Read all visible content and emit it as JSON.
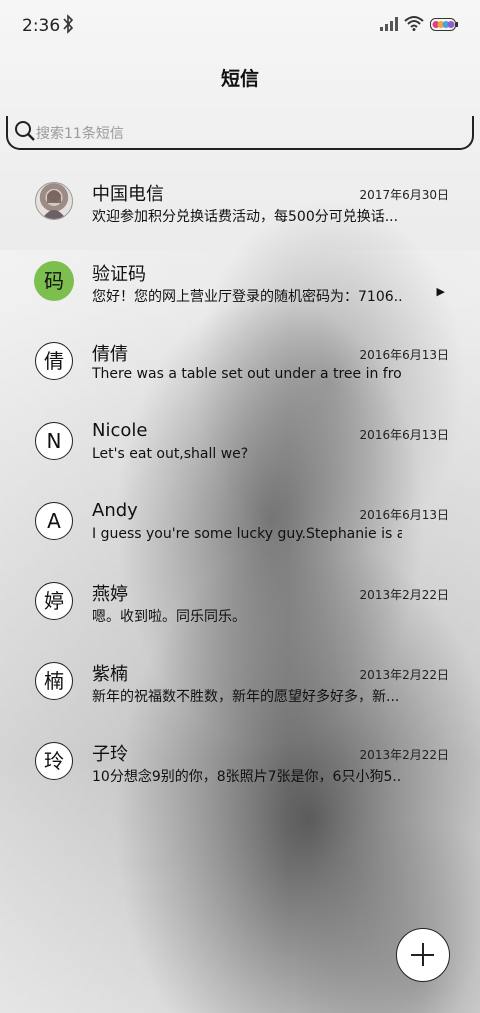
{
  "status_bar": {
    "time": "2:36"
  },
  "title": "短信",
  "search": {
    "placeholder": "搜索11条短信"
  },
  "conversations": [
    {
      "name": "中国电信",
      "date": "2017年6月30日",
      "preview": "欢迎参加积分兑换话费活动，每500分可兑换话...",
      "avatar_type": "photo",
      "avatar_char": ""
    },
    {
      "name": "验证码",
      "date": "",
      "preview": "您好！您的网上营业厅登录的随机密码为：7106...",
      "avatar_type": "green",
      "avatar_char": "码"
    },
    {
      "name": "倩倩",
      "date": "2016年6月13日",
      "preview": "There was a table set out under a tree in fron...",
      "avatar_type": "circle",
      "avatar_char": "倩"
    },
    {
      "name": "Nicole",
      "date": "2016年6月13日",
      "preview": "Let's eat out,shall we?",
      "avatar_type": "circle",
      "avatar_char": "N"
    },
    {
      "name": "Andy",
      "date": "2016年6月13日",
      "preview": "I guess you're some lucky guy.Stephanie is a...",
      "avatar_type": "circle",
      "avatar_char": "A"
    },
    {
      "name": "燕婷",
      "date": "2013年2月22日",
      "preview": "嗯。收到啦。同乐同乐。",
      "avatar_type": "circle",
      "avatar_char": "婷"
    },
    {
      "name": "紫楠",
      "date": "2013年2月22日",
      "preview": "新年的祝福数不胜数，新年的愿望好多好多，新...",
      "avatar_type": "circle",
      "avatar_char": "楠"
    },
    {
      "name": "子玲",
      "date": "2013年2月22日",
      "preview": "10分想念9别的你，8张照片7张是你，6只小狗5...",
      "avatar_type": "circle",
      "avatar_char": "玲"
    }
  ],
  "icons": {
    "bluetooth": "bluetooth-icon",
    "signal": "signal-icon",
    "wifi": "wifi-icon",
    "battery": "battery-icon",
    "search": "search-icon",
    "expand": "play-arrow-icon",
    "compose": "plus-icon"
  }
}
